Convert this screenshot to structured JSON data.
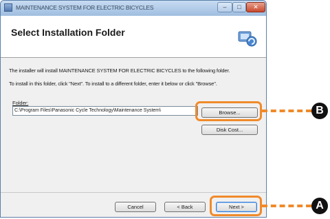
{
  "window": {
    "title": "MAINTENANCE SYSTEM FOR ELECTRIC BICYCLES",
    "minimize": "–",
    "maximize": "□",
    "close": "✕"
  },
  "banner": {
    "title": "Select Installation Folder"
  },
  "body": {
    "line1": "The installer will install MAINTENANCE SYSTEM FOR ELECTRIC BICYCLES to the following folder.",
    "line2": "To install in this folder, click \"Next\". To install to a different folder, enter it below or click \"Browse\"."
  },
  "folder": {
    "label": "Folder:",
    "value": "C:\\Program Files\\Panasonic Cycle Technology\\Maintenance System\\"
  },
  "buttons": {
    "browse": "Browse...",
    "disk_cost": "Disk Cost...",
    "cancel": "Cancel",
    "back": "< Back",
    "next": "Next >"
  },
  "callouts": {
    "a": "A",
    "b": "B"
  },
  "colors": {
    "callout": "#f08a2a",
    "marker": "#111111"
  }
}
